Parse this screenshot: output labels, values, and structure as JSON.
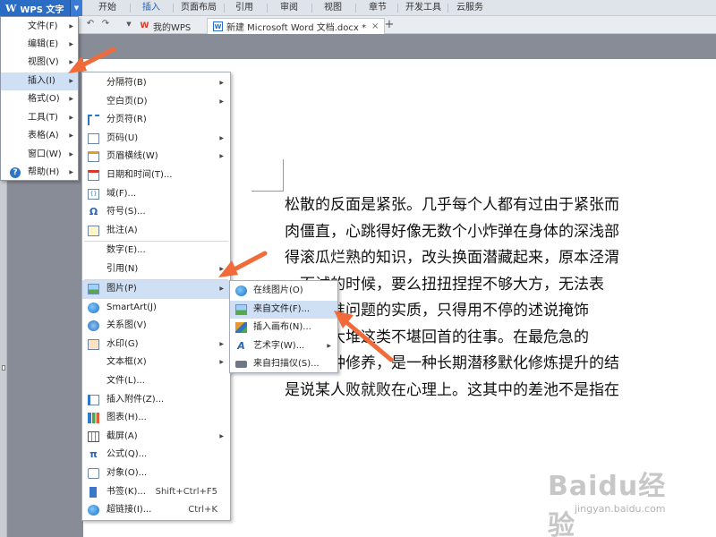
{
  "colors": {
    "accent": "#2b6cc4",
    "highlight": "#cfe0f5",
    "arrow": "#f06a3a"
  },
  "app": {
    "logo": "W",
    "name": "WPS 文字"
  },
  "ribbon_tabs": [
    "开始",
    "插入",
    "页面布局",
    "引用",
    "审阅",
    "视图",
    "章节",
    "开发工具",
    "云服务"
  ],
  "doc_tabs": [
    {
      "label": "我的WPS"
    },
    {
      "label": "新建 Microsoft Word 文档.docx *"
    }
  ],
  "main_menu": [
    {
      "label": "文件(F)",
      "submenu": true
    },
    {
      "label": "编辑(E)",
      "submenu": true
    },
    {
      "label": "视图(V)",
      "submenu": true
    },
    {
      "label": "插入(I)",
      "submenu": true,
      "active": true
    },
    {
      "label": "格式(O)",
      "submenu": true
    },
    {
      "label": "工具(T)",
      "submenu": true
    },
    {
      "label": "表格(A)",
      "submenu": true
    },
    {
      "label": "窗口(W)",
      "submenu": true
    },
    {
      "label": "帮助(H)",
      "submenu": true,
      "icon": "help-icon"
    }
  ],
  "insert_menu": [
    {
      "label": "分隔符(B)",
      "submenu": true,
      "icon": ""
    },
    {
      "label": "空白页(D)",
      "submenu": true,
      "icon": ""
    },
    {
      "label": "分页符(R)",
      "icon": "page-break-icon"
    },
    {
      "label": "页码(U)",
      "submenu": true,
      "icon": "page-number-icon"
    },
    {
      "label": "页眉横线(W)",
      "submenu": true,
      "icon": "header-line-icon"
    },
    {
      "label": "日期和时间(T)...",
      "icon": "calendar-icon"
    },
    {
      "label": "域(F)...",
      "icon": "field-icon"
    },
    {
      "label": "符号(S)...",
      "icon": "omega-icon"
    },
    {
      "label": "批注(A)",
      "icon": "comment-icon"
    },
    {
      "label": "数字(E)...",
      "icon": "",
      "separator_before": true
    },
    {
      "label": "引用(N)",
      "submenu": true,
      "icon": ""
    },
    {
      "label": "图片(P)",
      "submenu": true,
      "icon": "picture-icon",
      "active": true,
      "separator_before": true
    },
    {
      "label": "SmartArt(J)",
      "icon": "smartart-icon"
    },
    {
      "label": "关系图(V)",
      "icon": "relation-icon"
    },
    {
      "label": "水印(G)",
      "submenu": true,
      "icon": "watermark-icon"
    },
    {
      "label": "文本框(X)",
      "submenu": true,
      "icon": ""
    },
    {
      "label": "文件(L)...",
      "icon": ""
    },
    {
      "label": "插入附件(Z)...",
      "icon": "attachment-icon"
    },
    {
      "label": "图表(H)...",
      "icon": "chart-icon"
    },
    {
      "label": "截屏(A)",
      "submenu": true,
      "icon": "screenshot-icon"
    },
    {
      "label": "公式(Q)...",
      "icon": "pi-icon"
    },
    {
      "label": "对象(O)...",
      "icon": "object-icon"
    },
    {
      "label": "书签(K)...",
      "icon": "bookmark-icon",
      "shortcut": "Shift+Ctrl+F5"
    },
    {
      "label": "超链接(I)...",
      "icon": "hyperlink-icon",
      "shortcut": "Ctrl+K"
    }
  ],
  "picture_menu": [
    {
      "label": "在线图片(O)",
      "icon": "online-picture-icon"
    },
    {
      "label": "来自文件(F)...",
      "icon": "picture-file-icon",
      "active": true
    },
    {
      "label": "插入画布(N)...",
      "icon": "canvas-icon"
    },
    {
      "label": "艺术字(W)...",
      "icon": "wordart-icon",
      "submenu": true
    },
    {
      "label": "来自扫描仪(S)...",
      "icon": "scanner-icon"
    }
  ],
  "document_lines": [
    "松散的反面是紧张。几乎每个人都有过由于紧张而",
    "肉僵直，心跳得好像无数个小炸弹在身体的深浅部",
    "得滚瓜烂熟的知识，改头换面潜藏起来，原本泾渭",
    "一面试的时候，要么扭扭捏捏不够大方，无法表",
    "拿捏不准问题的实质，只得用不停的述说掩饰",
    "一了一大堆这类不堪回首的往事。在最危急的",
    "而是一种修养，是一种长期潜移默化修炼提升的结",
    "是说某人败就败在心理上。这其中的差池不是指在"
  ],
  "watermark": {
    "main": "Baidu经验",
    "sub": "jingyan.baidu.com"
  }
}
